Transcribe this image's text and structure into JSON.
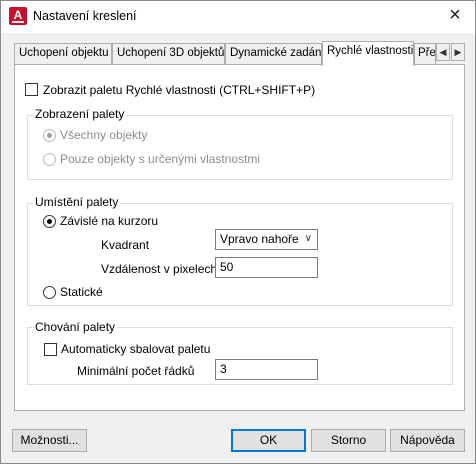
{
  "window": {
    "title": "Nastavení kreslení",
    "app_icon_letter": "A"
  },
  "tabs": [
    {
      "label": "Uchopení objektu",
      "active": false
    },
    {
      "label": "Uchopení 3D objektů",
      "active": false
    },
    {
      "label": "Dynamické zadání",
      "active": false
    },
    {
      "label": "Rychlé vlastnosti",
      "active": true
    },
    {
      "label": "Pře",
      "active": false
    }
  ],
  "main": {
    "show_palette_checkbox": {
      "label": "Zobrazit paletu Rychlé vlastnosti (CTRL+SHIFT+P)",
      "checked": false
    },
    "palette_display": {
      "title": "Zobrazení palety",
      "options": [
        {
          "label": "Všechny objekty",
          "checked": true,
          "disabled": true
        },
        {
          "label": "Pouze objekty s určenými vlastnostmi",
          "checked": false,
          "disabled": true
        }
      ]
    },
    "palette_location": {
      "title": "Umístění palety",
      "cursor_dependent": {
        "label": "Závislé na kurzoru",
        "checked": true
      },
      "quadrant_label": "Kvadrant",
      "quadrant_value": "Vpravo nahoře",
      "distance_label": "Vzdálenost v pixelech",
      "distance_value": "50",
      "static": {
        "label": "Statické",
        "checked": false
      }
    },
    "palette_behavior": {
      "title": "Chování palety",
      "auto_collapse": {
        "label": "Automaticky sbalovat paletu",
        "checked": false
      },
      "min_rows_label": "Minimální počet řádků",
      "min_rows_value": "3"
    }
  },
  "footer": {
    "options_label": "Možnosti...",
    "ok_label": "OK",
    "cancel_label": "Storno",
    "help_label": "Nápověda"
  },
  "colors": {
    "accent": "#0078d7",
    "app_icon": "#c8102e"
  }
}
